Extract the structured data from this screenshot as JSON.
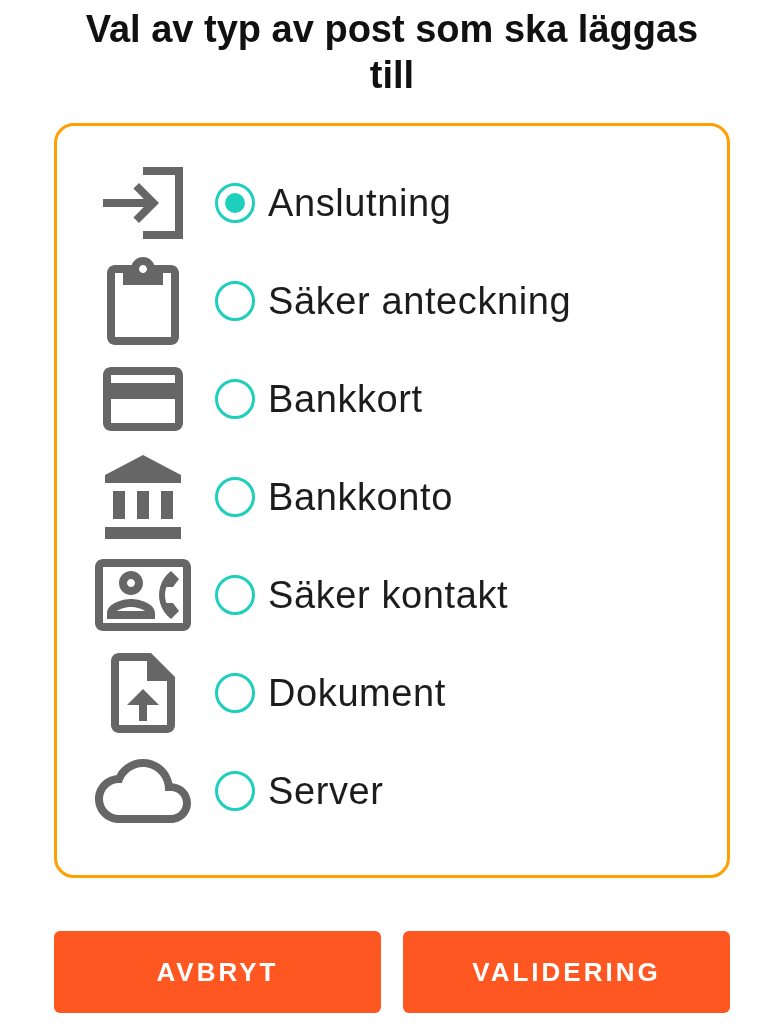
{
  "title": "Val av typ av post som ska läggas till",
  "options": [
    {
      "label": "Anslutning",
      "selected": true
    },
    {
      "label": "Säker anteckning",
      "selected": false
    },
    {
      "label": "Bankkort",
      "selected": false
    },
    {
      "label": "Bankkonto",
      "selected": false
    },
    {
      "label": "Säker kontakt",
      "selected": false
    },
    {
      "label": "Dokument",
      "selected": false
    },
    {
      "label": "Server",
      "selected": false
    }
  ],
  "buttons": [
    "AVBRYT",
    "VALIDERING"
  ]
}
